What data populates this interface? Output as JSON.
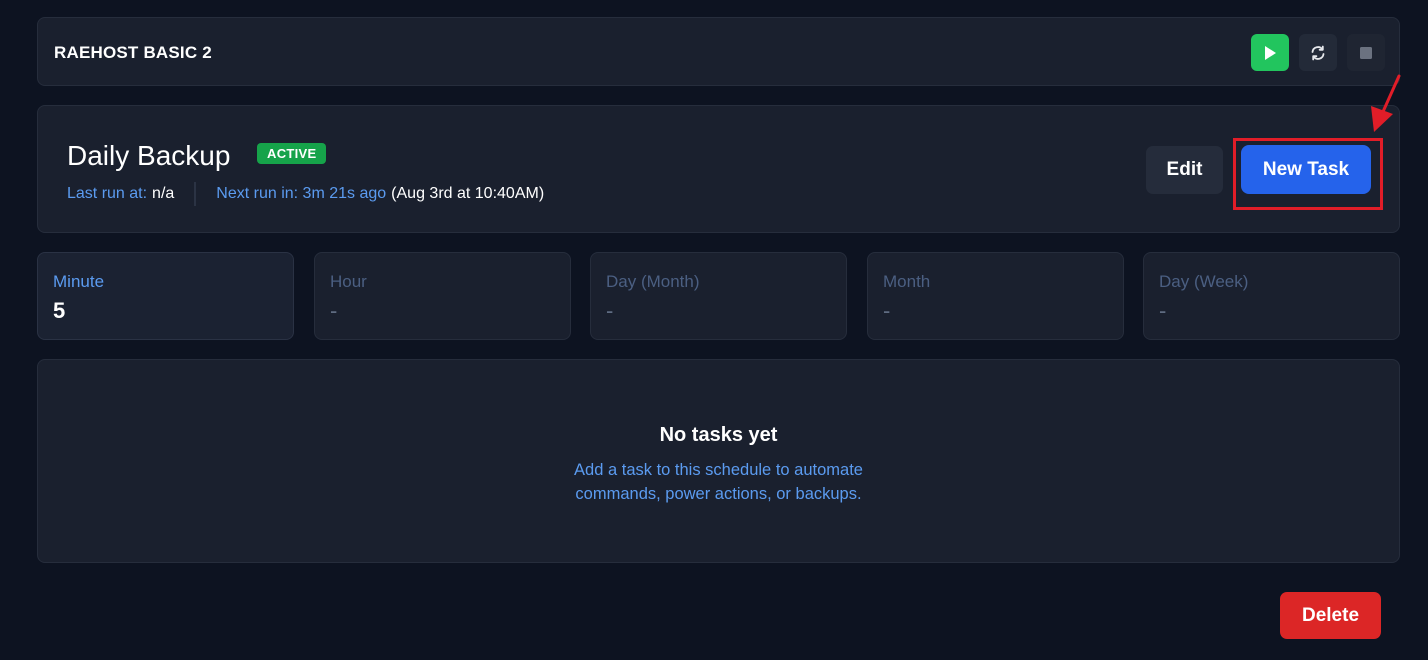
{
  "server": {
    "name": "RAEHOST BASIC 2",
    "power_buttons": [
      {
        "icon": "play-icon",
        "color": "#22c55e"
      },
      {
        "icon": "refresh-icon"
      },
      {
        "icon": "stop-icon"
      }
    ]
  },
  "schedule": {
    "title": "Daily Backup",
    "status_badge": "ACTIVE",
    "last_run_label": "Last run at:",
    "last_run_value": "n/a",
    "next_run_label": "Next run in: 3m 21s ago",
    "next_run_value": "(Aug 3rd at 10:40AM)",
    "edit_label": "Edit",
    "new_task_label": "New Task"
  },
  "cron": [
    {
      "label": "Minute",
      "value": "5"
    },
    {
      "label": "Hour",
      "value": "-"
    },
    {
      "label": "Day (Month)",
      "value": "-"
    },
    {
      "label": "Month",
      "value": "-"
    },
    {
      "label": "Day (Week)",
      "value": "-"
    }
  ],
  "tasks": {
    "empty_title": "No tasks yet",
    "empty_description": "Add a task to this schedule to automate commands, power actions, or backups."
  },
  "delete_label": "Delete",
  "colors": {
    "background": "#0d1321",
    "card": "#1a202e",
    "accent_blue": "#2563eb",
    "link_blue": "#5b9bf0",
    "success": "#16a34a",
    "danger": "#dc2626",
    "annotation": "#e11d28"
  }
}
